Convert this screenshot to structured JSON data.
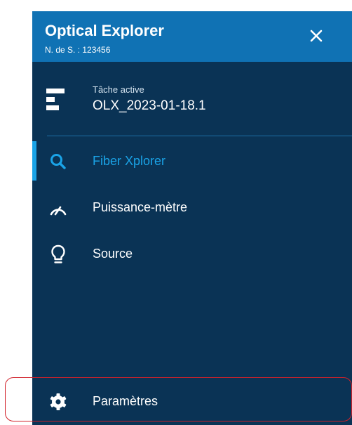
{
  "header": {
    "title": "Optical Explorer",
    "serial": "N. de S. : 123456",
    "close_icon": "close-icon"
  },
  "task": {
    "label": "Tâche active",
    "name": "OLX_2023-01-18.1",
    "icon": "task-bars-icon"
  },
  "nav": {
    "items": [
      {
        "label": "Fiber Xplorer",
        "icon": "search-icon",
        "active": true
      },
      {
        "label": "Puissance-mètre",
        "icon": "gauge-icon",
        "active": false
      },
      {
        "label": "Source",
        "icon": "lightbulb-icon",
        "active": false
      }
    ]
  },
  "settings": {
    "label": "Paramètres",
    "icon": "gear-icon",
    "highlighted": true
  },
  "colors": {
    "panel_bg": "#0a3355",
    "header_bg": "#1072b4",
    "accent": "#1aa4e8",
    "highlight_outline": "#d1212a"
  }
}
